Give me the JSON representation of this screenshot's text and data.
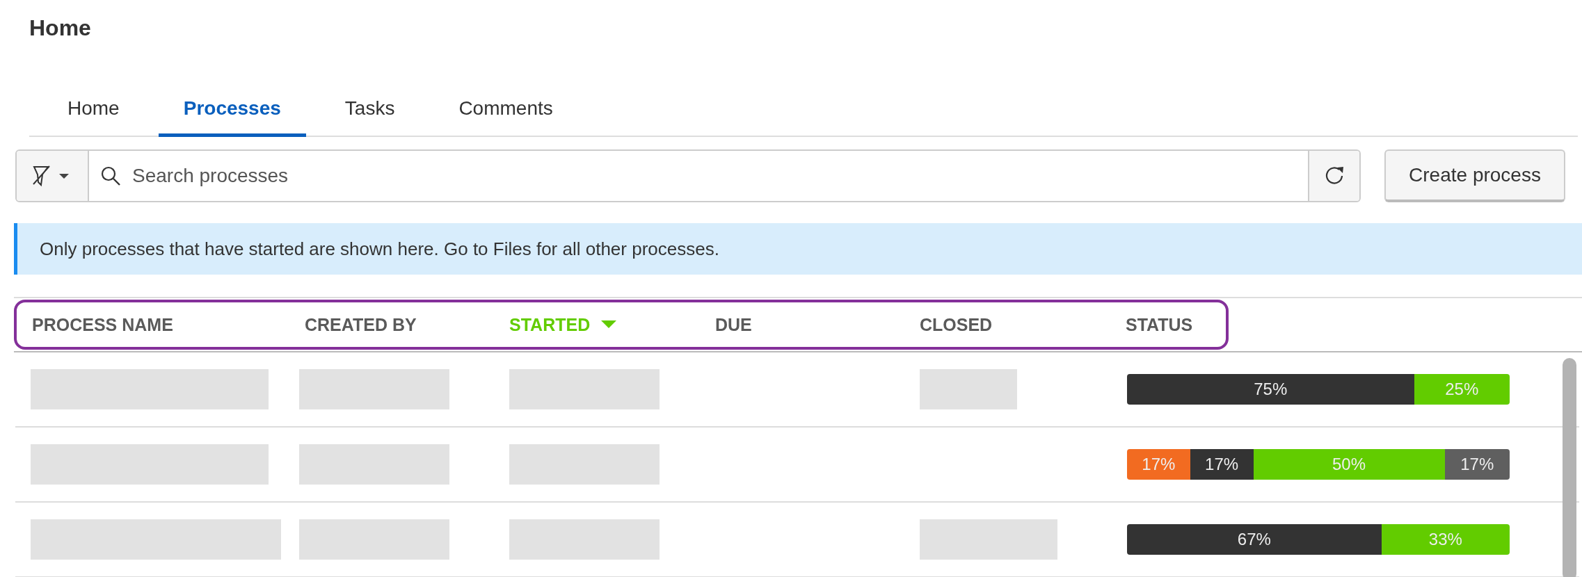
{
  "page_title": "Home",
  "tabs": [
    {
      "label": "Home",
      "selected": false
    },
    {
      "label": "Processes",
      "selected": true
    },
    {
      "label": "Tasks",
      "selected": false
    },
    {
      "label": "Comments",
      "selected": false
    }
  ],
  "search": {
    "placeholder": "Search processes"
  },
  "create_button": "Create process",
  "banner": "Only processes that have started are shown here. Go to Files for all other processes.",
  "table": {
    "header_highlighted": true,
    "columns": [
      {
        "label": "PROCESS NAME",
        "sorted": false
      },
      {
        "label": "CREATED BY",
        "sorted": false
      },
      {
        "label": "STARTED",
        "sorted": true
      },
      {
        "label": "DUE",
        "sorted": false
      },
      {
        "label": "CLOSED",
        "sorted": false
      },
      {
        "label": "STATUS",
        "sorted": false
      }
    ],
    "rows": [
      {
        "cells": [
          {
            "loading": true
          },
          {
            "loading": true
          },
          {
            "loading": true
          },
          {
            "loading": false
          },
          {
            "loading": true
          }
        ],
        "status": [
          {
            "label": "75%",
            "color": "#333333"
          },
          {
            "label": "25%",
            "color": "#62cc00"
          }
        ]
      },
      {
        "cells": [
          {
            "loading": true
          },
          {
            "loading": true
          },
          {
            "loading": true
          },
          {
            "loading": false
          },
          {
            "loading": false
          }
        ],
        "status": [
          {
            "label": "17%",
            "color": "#f26b21"
          },
          {
            "label": "17%",
            "color": "#333333"
          },
          {
            "label": "50%",
            "color": "#62cc00"
          },
          {
            "label": "17%",
            "color": "#5f5f5f"
          }
        ]
      },
      {
        "cells": [
          {
            "loading": true
          },
          {
            "loading": true
          },
          {
            "loading": true
          },
          {
            "loading": false
          },
          {
            "loading": true
          }
        ],
        "status": [
          {
            "label": "67%",
            "color": "#333333"
          },
          {
            "label": "33%",
            "color": "#62cc00"
          }
        ]
      }
    ]
  }
}
